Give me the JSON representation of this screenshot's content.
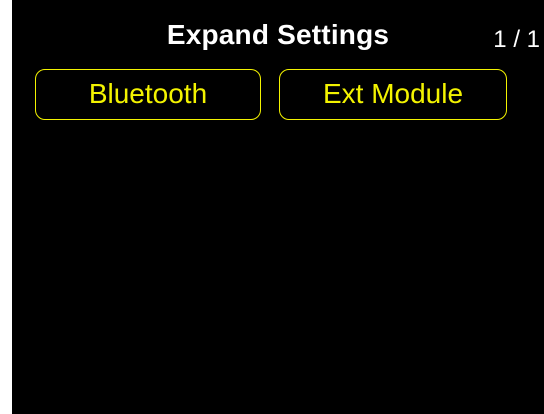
{
  "header": {
    "title": "Expand Settings",
    "page_indicator": "1 / 1"
  },
  "menu": {
    "items": [
      {
        "label": "Bluetooth"
      },
      {
        "label": "Ext Module"
      }
    ]
  },
  "colors": {
    "background": "#000000",
    "title_text": "#ffffff",
    "accent": "#f3f300"
  }
}
